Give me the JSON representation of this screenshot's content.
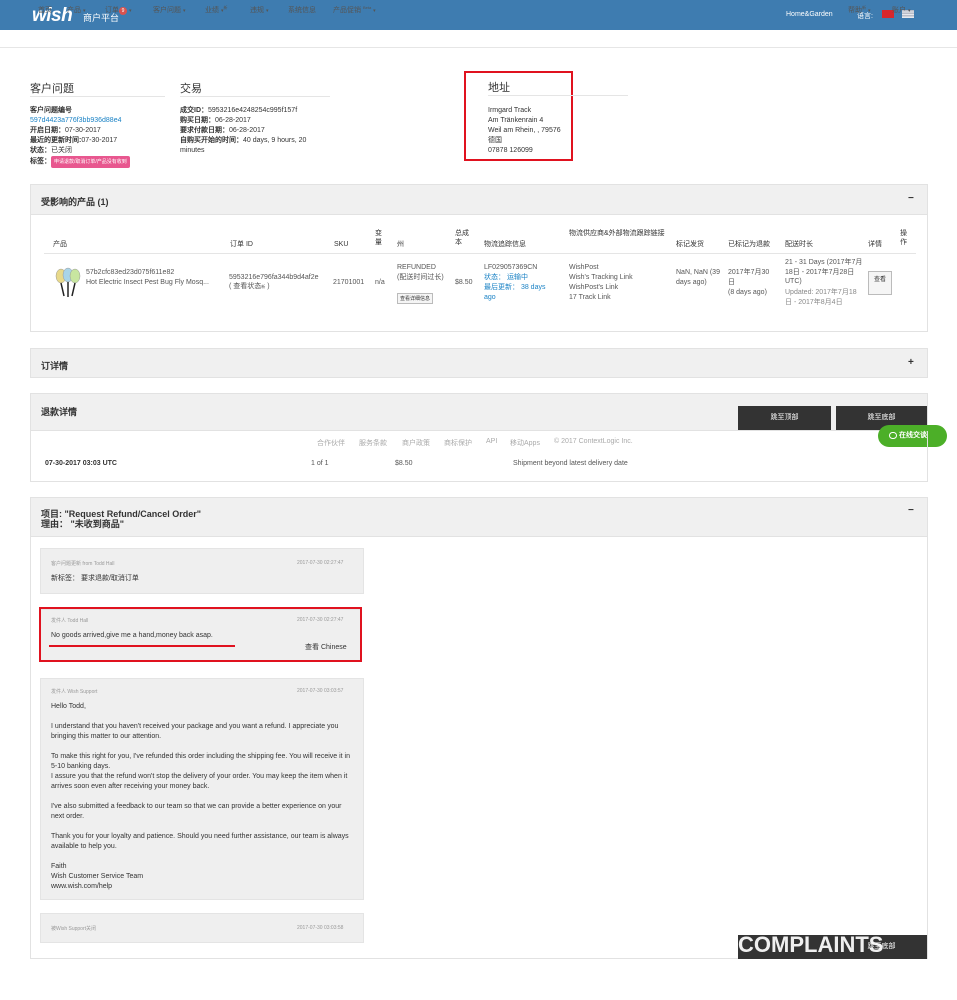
{
  "header": {
    "logo": "wish",
    "platform": "商户平台",
    "store": "Home&Garden",
    "lang_label": "语言:"
  },
  "nav": {
    "items": [
      {
        "label": "首页"
      },
      {
        "label": "产品"
      },
      {
        "label": "订单",
        "badge": "9"
      },
      {
        "label": "客户问题"
      },
      {
        "label": "业绩",
        "sup": "新"
      },
      {
        "label": "违规"
      },
      {
        "label": "系统信息"
      },
      {
        "label": "产品促销",
        "sup": "Beta"
      }
    ],
    "help": "帮助",
    "help_sup": "新",
    "account": "账户"
  },
  "ticket": {
    "title": "客户问题",
    "id_label": "客户问题编号",
    "id_value": "597d4423a776f3bb936d88e4",
    "open_label": "开启日期：",
    "open_value": "07-30-2017",
    "updated_label": "最近的更新时间:",
    "updated_value": "07-30-2017",
    "status_label": "状态：",
    "status_value": "已关闭",
    "tags_label": "标签：",
    "tag_value": "申请退款/取消订单/产品没有收到"
  },
  "transaction": {
    "title": "交易",
    "txn_label": "成交ID：",
    "txn_value": "5953216e4248254c995f157f",
    "buy_label": "购买日期：",
    "buy_value": "06-28-2017",
    "req_label": "要求付款日期：",
    "req_value": "06-28-2017",
    "since_label": "自购买开始的时间：",
    "since_value": "40 days, 9 hours, 20 minutes"
  },
  "address": {
    "title": "地址",
    "lines": [
      "Irmgard Track",
      "Am Tränkenrain 4",
      "Weil am Rhein, , 79576",
      "德国",
      "07878 126099"
    ]
  },
  "products": {
    "title": "受影响的产品 (1)",
    "collapse": "−",
    "headers": {
      "product": "产品",
      "order_id": "订单 ID",
      "sku": "SKU",
      "variant": "变量",
      "state": "州",
      "cost": "总成本",
      "tracking": "物流追踪信息",
      "carrier": "物流供应商&外部物流跟踪链接",
      "marked": "标记发货",
      "refund_marked": "已标记为退款",
      "delivery": "配送时长",
      "details": "详情",
      "ops": "操作"
    },
    "row": {
      "product_id": "57b2cfc83ed23d075f611e82",
      "product_name": "Hot Electric Insect Pest Bug Fly Mosq...",
      "order_id": "5953216e796fa344b9d4af2e",
      "view_status": "( 查看状态",
      "view_status_sup": "新",
      "view_status_end": " )",
      "sku": "21701001",
      "variant": "n/a",
      "state": "REFUNDED (配送时间过长)",
      "state_btn": "查看详细信息",
      "cost": "$8.50",
      "tracking_no": "LF029057369CN",
      "tracking_status_label": "状态：",
      "tracking_status": "运输中",
      "tracking_updated_label": "最后更新：",
      "tracking_updated": "38 days ago",
      "carrier": "WishPost",
      "carrier_links": [
        "Wish's Tracking Link",
        "WishPost's Link",
        "17 Track Link"
      ],
      "marked": "NaN, NaN (39 days ago)",
      "refund_marked": "2017年7月30日",
      "refund_ago": "(8 days ago)",
      "delivery": "21 - 31 Days (2017年7月18日 - 2017年7月28日 UTC)",
      "delivery_updated": "Updated: 2017年7月18日 - 2017年8月4日",
      "details_btn": "查看"
    }
  },
  "order_details": {
    "title": "订详情",
    "expand": "+"
  },
  "refund_details": {
    "title": "退款详情",
    "row": {
      "date": "07-30-2017 03:03 UTC",
      "qty": "1 of 1",
      "amount": "$8.50",
      "reason": "Shipment beyond latest delivery date"
    }
  },
  "float_buttons": {
    "top": "跳至顶部",
    "bottom": "跳至底部",
    "chat": "在线交谈"
  },
  "footer": {
    "links": [
      "合作伙伴",
      "服务条款",
      "商户政策",
      "商标保护",
      "API",
      "移动Apps"
    ],
    "copyright": "© 2017 ContextLogic Inc."
  },
  "issue": {
    "item_line": "项目: \"Request Refund/Cancel Order\"",
    "reason_line": "理由： \"未收到商品\"",
    "collapse": "−"
  },
  "messages": [
    {
      "meta": "客户问题更新 from Todd Hall",
      "time": "2017-07-30 02:27:47",
      "text": "新标签： 要求退款/取消订单"
    },
    {
      "meta": "发件人 Todd Hall",
      "time": "2017-07-30 02:27:47",
      "text": "No goods arrived,give me a hand,money back asap.",
      "translate": "查看 Chinese"
    },
    {
      "meta": "发件人 Wish Support",
      "time": "2017-07-30 03:03:57",
      "paragraphs": [
        "Hello Todd,",
        "I understand that you haven't received your package and you want a refund. I appreciate you bringing this matter to our attention.",
        "To make this right for you, I've refunded this order including the shipping fee. You will receive it in 5-10 banking days.\nI assure you that the refund won't stop the delivery of your order. You may keep the item when it arrives soon even after receiving your money back.",
        "I've also submitted a feedback to our team so that we can provide a better experience on your next order.",
        "Thank you for your loyalty and patience. Should you need further assistance, our team is always available to help you.",
        "Faith\nWish Customer Service Team\nwww.wish.com/help"
      ]
    },
    {
      "meta": "被Wish Support关闭",
      "time": "2017-07-30 03:03:58"
    }
  ],
  "watermark": "COMPLAINTS",
  "watermark_btn": "跳至底部",
  "colors": {
    "header": "#3e7cb0",
    "link": "#1a82c5",
    "highlight": "#e0121f",
    "tag": "#e8578f",
    "chat": "#4caf28"
  }
}
